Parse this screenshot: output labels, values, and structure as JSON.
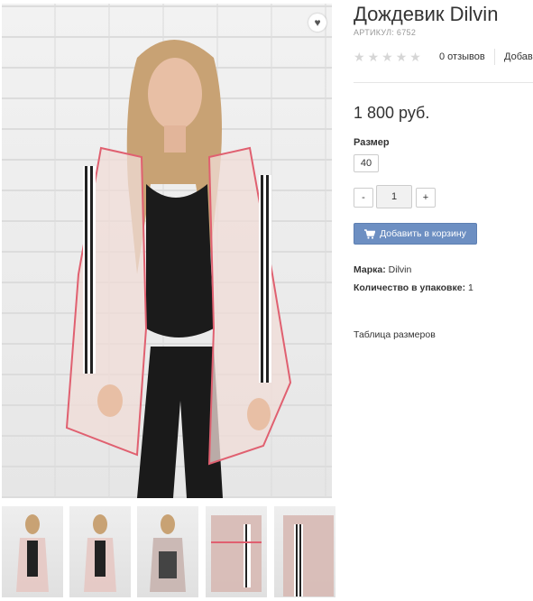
{
  "product": {
    "title": "Дождевик Dilvin",
    "sku_label": "АРТИКУЛ: 6752",
    "reviews_count": "0 отзывов",
    "add_review": "Добав",
    "rating": 0,
    "rating_max": 5,
    "price": "1 800 руб.",
    "size_label": "Размер",
    "size_option": "40",
    "qty_minus": "-",
    "qty_value": "1",
    "qty_plus": "+",
    "add_to_cart": "Добавить в корзину",
    "brand_label": "Марка:",
    "brand_value": "Dilvin",
    "pack_label": "Количество в упаковке:",
    "pack_value": "1",
    "size_table_link": "Таблица размеров"
  },
  "icons": {
    "favorite": "heart-icon",
    "cart": "cart-icon",
    "star": "star-icon"
  },
  "colors": {
    "accent_button": "#6d8fc2",
    "star_empty": "#d6d6d6"
  }
}
